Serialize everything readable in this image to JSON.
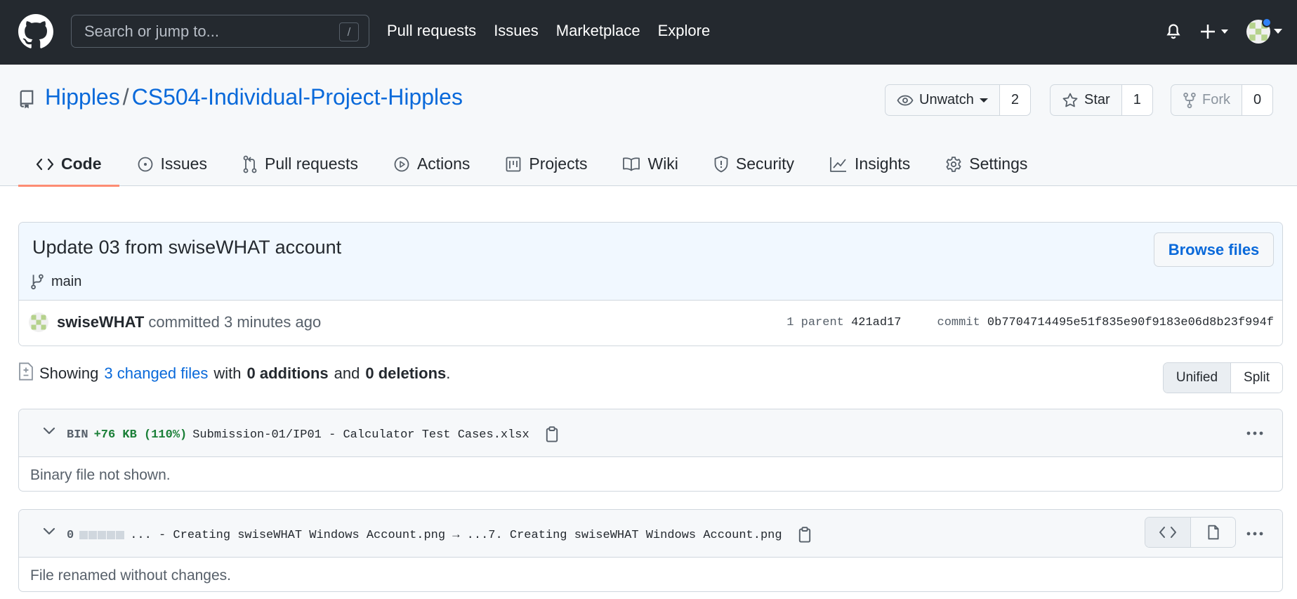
{
  "header": {
    "search_placeholder": "Search or jump to...",
    "search_shortcut": "/",
    "nav": [
      "Pull requests",
      "Issues",
      "Marketplace",
      "Explore"
    ]
  },
  "repo": {
    "owner": "Hipples",
    "separator": "/",
    "name": "CS504-Individual-Project-Hipples",
    "watch_label": "Unwatch",
    "watch_count": "2",
    "star_label": "Star",
    "star_count": "1",
    "fork_label": "Fork",
    "fork_count": "0"
  },
  "tabs": [
    {
      "label": "Code",
      "icon": "code-icon"
    },
    {
      "label": "Issues",
      "icon": "issue-opened-icon"
    },
    {
      "label": "Pull requests",
      "icon": "git-pull-request-icon"
    },
    {
      "label": "Actions",
      "icon": "play-icon"
    },
    {
      "label": "Projects",
      "icon": "project-icon"
    },
    {
      "label": "Wiki",
      "icon": "book-icon"
    },
    {
      "label": "Security",
      "icon": "shield-icon"
    },
    {
      "label": "Insights",
      "icon": "graph-icon"
    },
    {
      "label": "Settings",
      "icon": "gear-icon"
    }
  ],
  "commit": {
    "title": "Update 03 from swiseWHAT account",
    "branch": "main",
    "browse_label": "Browse files",
    "author": "swiseWHAT",
    "action": "committed 3 minutes ago",
    "parent_label": "1 parent",
    "parent_sha": "421ad17",
    "commit_label": "commit",
    "commit_sha": "0b7704714495e51f835e90f9183e06d8b23f994f"
  },
  "summary": {
    "showing": "Showing",
    "changed_files": "3 changed files",
    "with": "with",
    "additions": "0 additions",
    "and": "and",
    "deletions": "0 deletions",
    "period": ".",
    "unified_label": "Unified",
    "split_label": "Split"
  },
  "files": [
    {
      "kind": "BIN",
      "delta": "+76 KB (110%)",
      "path": "Submission-01/IP01 - Calculator Test Cases.xlsx",
      "body": "Binary file not shown."
    },
    {
      "kind": "0",
      "path": "... - Creating swiseWHAT Windows Account.png → ...7. Creating swiseWHAT Windows Account.png",
      "body": "File renamed without changes."
    }
  ],
  "colors": {
    "header_bg": "#24292f",
    "link": "#0969da",
    "tab_underline": "#fd8c73",
    "addition_green": "#1a7f37"
  }
}
